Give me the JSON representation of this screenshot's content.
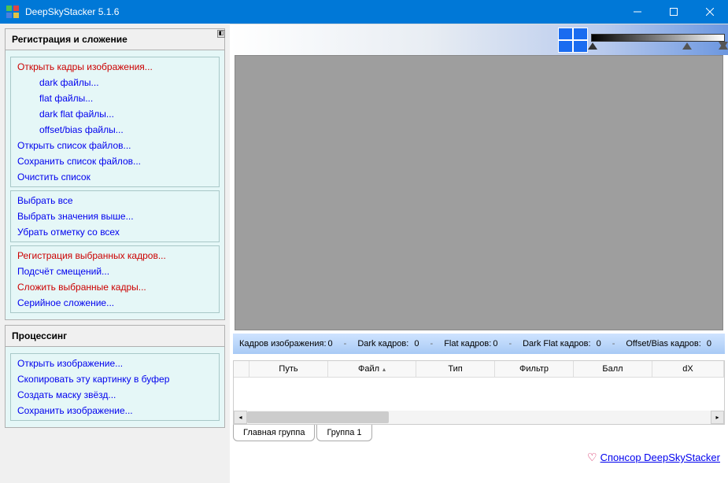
{
  "window": {
    "title": "DeepSkyStacker 5.1.6"
  },
  "sidebar": {
    "reg_header": "Регистрация и сложение",
    "open_image_frames": "Открыть кадры изображения...",
    "dark_files": "dark файлы...",
    "flat_files": "flat файлы...",
    "dark_flat_files": "dark flat файлы...",
    "offset_bias_files": "offset/bias файлы...",
    "open_file_list": "Открыть список файлов...",
    "save_file_list": "Сохранить список файлов...",
    "clear_list": "Очистить список",
    "select_all": "Выбрать все",
    "select_above": "Выбрать значения выше...",
    "unselect_all": "Убрать отметку со всех",
    "register_selected": "Регистрация выбранных кадров...",
    "compute_offsets": "Подсчёт смещений...",
    "stack_selected": "Сложить выбранные кадры...",
    "batch_stacking": "Серийное сложение...",
    "proc_header": "Процессинг",
    "open_image": "Открыть изображение...",
    "copy_to_clipboard": "Скопировать эту картинку в буфер",
    "create_star_mask": "Создать маску звёзд...",
    "save_image": "Сохранить изображение..."
  },
  "stats": {
    "image_frames_label": "Кадров изображения:",
    "image_frames_val": "0",
    "dark_label": "Dark кадров:",
    "dark_val": "0",
    "flat_label": "Flat кадров:",
    "flat_val": "0",
    "darkflat_label": "Dark Flat кадров:",
    "darkflat_val": "0",
    "offsetbias_label": "Offset/Bias кадров:",
    "offsetbias_val": "0"
  },
  "table": {
    "cols": {
      "path": "Путь",
      "file": "Файл",
      "type": "Тип",
      "filter": "Фильтр",
      "score": "Балл",
      "dx": "dX"
    }
  },
  "tabs": {
    "main_group": "Главная группа",
    "group_1": "Группа 1"
  },
  "sponsor": {
    "text": "Спонсор DeepSkyStacker"
  }
}
